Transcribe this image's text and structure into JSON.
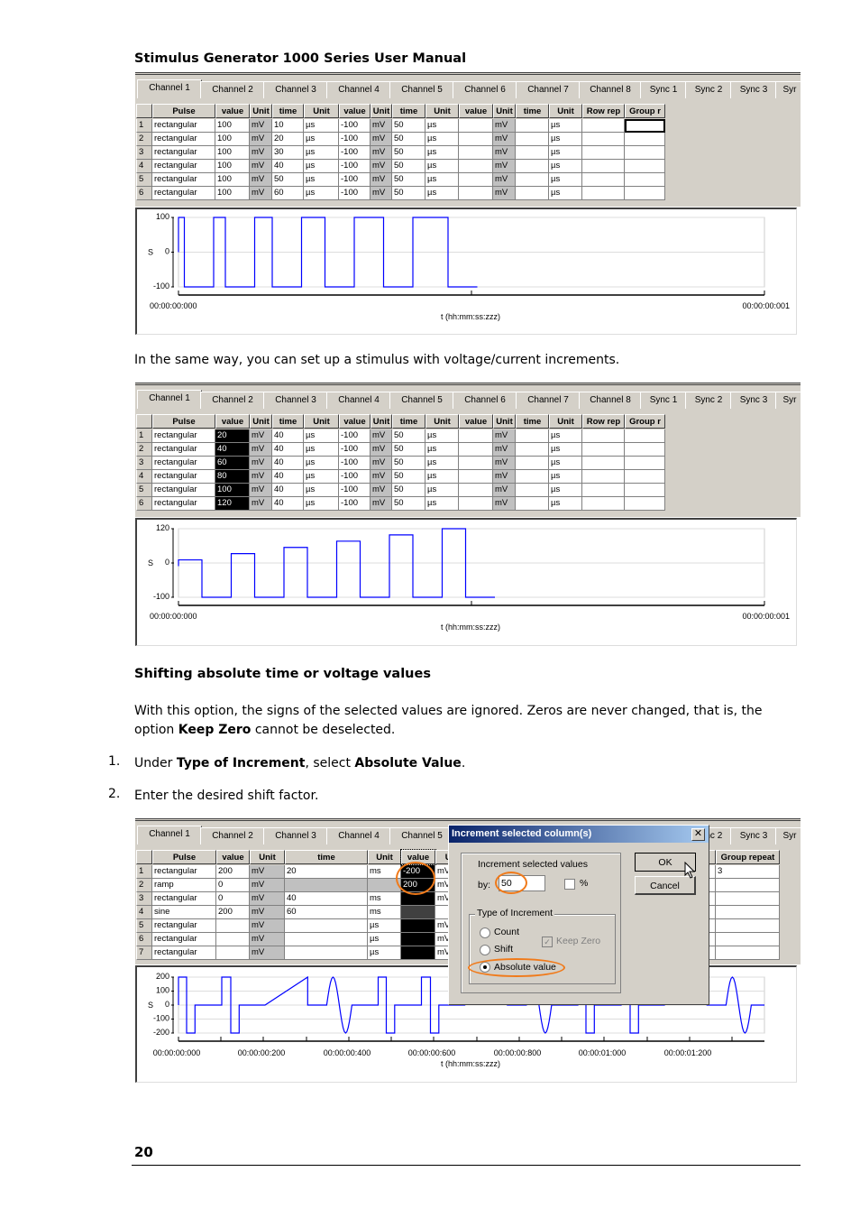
{
  "header": {
    "title": "Stimulus Generator 1000 Series User Manual"
  },
  "figures": [
    {
      "tabs": [
        "Channel 1",
        "Channel 2",
        "Channel 3",
        "Channel 4",
        "Channel 5",
        "Channel 6",
        "Channel 7",
        "Channel 8",
        "Sync 1",
        "Sync 2",
        "Sync 3",
        "Syr"
      ],
      "columns": [
        "",
        "Pulse",
        "value",
        "Unit",
        "time",
        "Unit",
        "value",
        "Unit",
        "time",
        "Unit",
        "value",
        "Unit",
        "time",
        "Unit",
        "Row rep",
        "Group r"
      ],
      "rows": [
        [
          "1",
          "rectangular",
          "100",
          "mV",
          "10",
          "µs",
          "-100",
          "mV",
          "50",
          "µs",
          "",
          "mV",
          "",
          "µs",
          "",
          ""
        ],
        [
          "2",
          "rectangular",
          "100",
          "mV",
          "20",
          "µs",
          "-100",
          "mV",
          "50",
          "µs",
          "",
          "mV",
          "",
          "µs",
          "",
          ""
        ],
        [
          "3",
          "rectangular",
          "100",
          "mV",
          "30",
          "µs",
          "-100",
          "mV",
          "50",
          "µs",
          "",
          "mV",
          "",
          "µs",
          "",
          ""
        ],
        [
          "4",
          "rectangular",
          "100",
          "mV",
          "40",
          "µs",
          "-100",
          "mV",
          "50",
          "µs",
          "",
          "mV",
          "",
          "µs",
          "",
          ""
        ],
        [
          "5",
          "rectangular",
          "100",
          "mV",
          "50",
          "µs",
          "-100",
          "mV",
          "50",
          "µs",
          "",
          "mV",
          "",
          "µs",
          "",
          ""
        ],
        [
          "6",
          "rectangular",
          "100",
          "mV",
          "60",
          "µs",
          "-100",
          "mV",
          "50",
          "µs",
          "",
          "mV",
          "",
          "µs",
          "",
          ""
        ]
      ],
      "plot": {
        "y_label": "S",
        "y_ticks": [
          "100",
          "0",
          "-100"
        ],
        "x_ticks": [
          "00:00:00:000",
          "00:00:00:001"
        ],
        "x_label": "t (hh:mm:ss:zzz)"
      }
    },
    {
      "tabs": [
        "Channel 1",
        "Channel 2",
        "Channel 3",
        "Channel 4",
        "Channel 5",
        "Channel 6",
        "Channel 7",
        "Channel 8",
        "Sync 1",
        "Sync 2",
        "Sync 3",
        "Syr"
      ],
      "columns": [
        "",
        "Pulse",
        "value",
        "Unit",
        "time",
        "Unit",
        "value",
        "Unit",
        "time",
        "Unit",
        "value",
        "Unit",
        "time",
        "Unit",
        "Row rep",
        "Group r"
      ],
      "rows": [
        [
          "1",
          "rectangular",
          "20",
          "mV",
          "40",
          "µs",
          "-100",
          "mV",
          "50",
          "µs",
          "",
          "mV",
          "",
          "µs",
          "",
          ""
        ],
        [
          "2",
          "rectangular",
          "40",
          "mV",
          "40",
          "µs",
          "-100",
          "mV",
          "50",
          "µs",
          "",
          "mV",
          "",
          "µs",
          "",
          ""
        ],
        [
          "3",
          "rectangular",
          "60",
          "mV",
          "40",
          "µs",
          "-100",
          "mV",
          "50",
          "µs",
          "",
          "mV",
          "",
          "µs",
          "",
          ""
        ],
        [
          "4",
          "rectangular",
          "80",
          "mV",
          "40",
          "µs",
          "-100",
          "mV",
          "50",
          "µs",
          "",
          "mV",
          "",
          "µs",
          "",
          ""
        ],
        [
          "5",
          "rectangular",
          "100",
          "mV",
          "40",
          "µs",
          "-100",
          "mV",
          "50",
          "µs",
          "",
          "mV",
          "",
          "µs",
          "",
          ""
        ],
        [
          "6",
          "rectangular",
          "120",
          "mV",
          "40",
          "µs",
          "-100",
          "mV",
          "50",
          "µs",
          "",
          "mV",
          "",
          "µs",
          "",
          ""
        ]
      ],
      "plot": {
        "y_label": "S",
        "y_ticks": [
          "120",
          "0",
          "-100"
        ],
        "x_ticks": [
          "00:00:00:000",
          "00:00:00:001"
        ],
        "x_label": "t (hh:mm:ss:zzz)"
      }
    },
    {
      "tabs": [
        "Channel 1",
        "Channel 2",
        "Channel 3",
        "Channel 4",
        "Channel 5",
        "Sync 2",
        "Sync 3",
        "Syr"
      ],
      "columns": [
        "",
        "Pulse",
        "value",
        "Unit",
        "time",
        "Unit",
        "value",
        "Unit",
        "",
        "",
        "",
        "",
        "",
        "Group repeat"
      ],
      "rows": [
        [
          "1",
          "rectangular",
          "200",
          "mV",
          "20",
          "ms",
          "-200",
          "mV",
          "",
          "",
          "",
          "",
          "",
          "3"
        ],
        [
          "2",
          "ramp",
          "0",
          "mV",
          "",
          "",
          "200",
          "mV",
          "",
          "",
          "",
          "",
          "",
          ""
        ],
        [
          "3",
          "rectangular",
          "0",
          "mV",
          "40",
          "ms",
          "",
          "mV",
          "",
          "",
          "",
          "",
          "",
          ""
        ],
        [
          "4",
          "sine",
          "200",
          "mV",
          "60",
          "ms",
          "",
          "",
          "",
          "",
          "",
          "",
          "",
          ""
        ],
        [
          "5",
          "rectangular",
          "",
          "mV",
          "",
          "µs",
          "",
          "mV",
          "",
          "",
          "",
          "",
          "",
          ""
        ],
        [
          "6",
          "rectangular",
          "",
          "mV",
          "",
          "µs",
          "",
          "mV",
          "",
          "",
          "",
          "",
          "",
          ""
        ],
        [
          "7",
          "rectangular",
          "",
          "mV",
          "",
          "µs",
          "",
          "mV",
          "",
          "",
          "",
          "",
          "",
          ""
        ]
      ],
      "plot": {
        "y_label": "S",
        "y_ticks": [
          "200",
          "100",
          "0",
          "-100",
          "-200"
        ],
        "x_ticks": [
          "00:00:00:000",
          "00:00:00:200",
          "00:00:00:400",
          "00:00:00:600",
          "00:00:00:800",
          "00:00:01:000",
          "00:00:01:200"
        ],
        "x_label": "t (hh:mm:ss:zzz)"
      }
    }
  ],
  "text": {
    "p1": "In the same way, you can set up a stimulus with voltage/current increments.",
    "h2": "Shifting absolute time or voltage values",
    "p2_a": "With this option, the signs of the selected values are ignored. Zeros are never changed, that is, the option ",
    "p2_b": "Keep Zero",
    "p2_c": " cannot be deselected.",
    "steps": [
      {
        "num": "1.",
        "a": "Under ",
        "b": "Type of Increment",
        "c": ", select ",
        "d": "Absolute Value",
        "e": "."
      },
      {
        "num": "2.",
        "a": "Enter the desired shift factor."
      }
    ]
  },
  "dialog": {
    "title": "Increment selected column(s)",
    "close": "✕",
    "group1_label": "Increment selected values",
    "by_label": "by:",
    "by_value": "50",
    "percent_label": "%",
    "percent_checked": false,
    "group2_label": "Type of Increment",
    "options": [
      "Count",
      "Shift",
      "Absolute value"
    ],
    "selected": "Absolute value",
    "keep_zero_label": "Keep Zero",
    "keep_zero_checked": true,
    "ok": "OK",
    "cancel": "Cancel"
  },
  "colors": {
    "waveform": "#0000ff",
    "highlight_ring": "#f07a1a",
    "titlebar": "#0a246a"
  },
  "footer": {
    "page": "20"
  }
}
